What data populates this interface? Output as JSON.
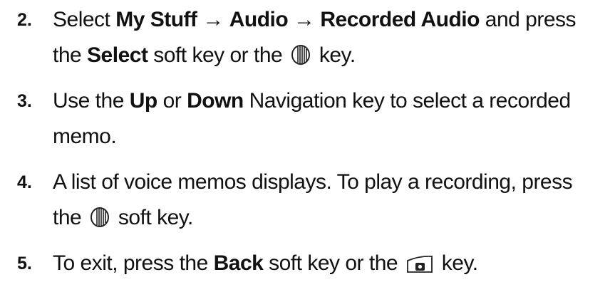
{
  "steps": [
    {
      "number": "2.",
      "line1": {
        "t1": "Select ",
        "b1": "My Stuff",
        "arrow1": " → ",
        "b2": "Audio",
        "arrow2": " → ",
        "b3": "Recorded Audio",
        "t2": " and press"
      },
      "line2": {
        "t1": "the ",
        "b1": "Select",
        "t2": " soft key or the ",
        "icon": "ok-key-icon",
        "t3": " key."
      }
    },
    {
      "number": "3.",
      "line1": {
        "t1": "Use the ",
        "b1": "Up",
        "t2": " or ",
        "b2": "Down",
        "t3": " Navigation key to select a recorded"
      },
      "line2": {
        "t1": "memo."
      }
    },
    {
      "number": "4.",
      "line1": {
        "t1": "A list of voice memos displays. To play a recording, press"
      },
      "line2": {
        "t1": "the ",
        "icon": "ok-key-icon",
        "t2": " soft key."
      }
    },
    {
      "number": "5.",
      "line1": {
        "t1": "To exit, press the ",
        "b1": "Back",
        "t2": " soft key or the ",
        "icon": "back-key-icon",
        "t3": " key."
      }
    }
  ]
}
